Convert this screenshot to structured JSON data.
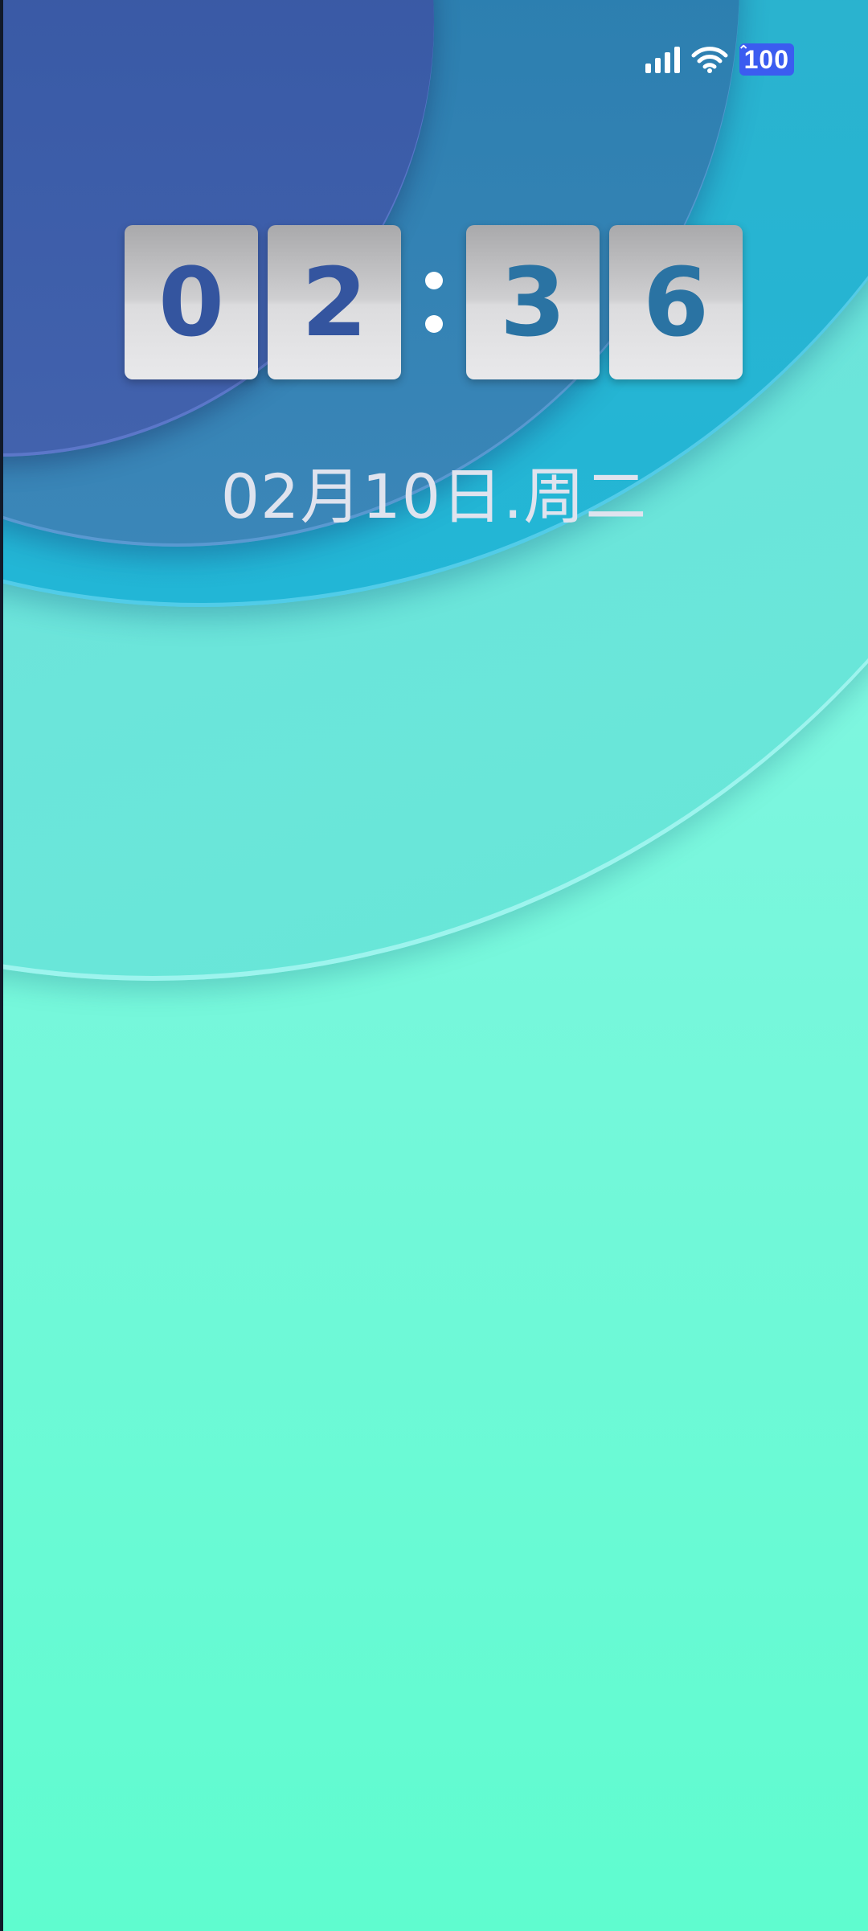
{
  "status_bar": {
    "signal_icon": "cellular-signal-icon",
    "wifi_icon": "wifi-icon",
    "battery_level": "100",
    "battery_badge_color": "#3b5cf0"
  },
  "clock": {
    "hour_tens": "0",
    "hour_ones": "2",
    "minute_tens": "3",
    "minute_ones": "6",
    "hour_color": "#34559f",
    "minute_color": "#2a73a3"
  },
  "date": {
    "text": "02月10日.周二"
  },
  "wallpaper": {
    "colors": [
      "#3b5ca8",
      "#2c7fb0",
      "#22b6d6",
      "#6ee3dc",
      "#5ffccf"
    ]
  }
}
